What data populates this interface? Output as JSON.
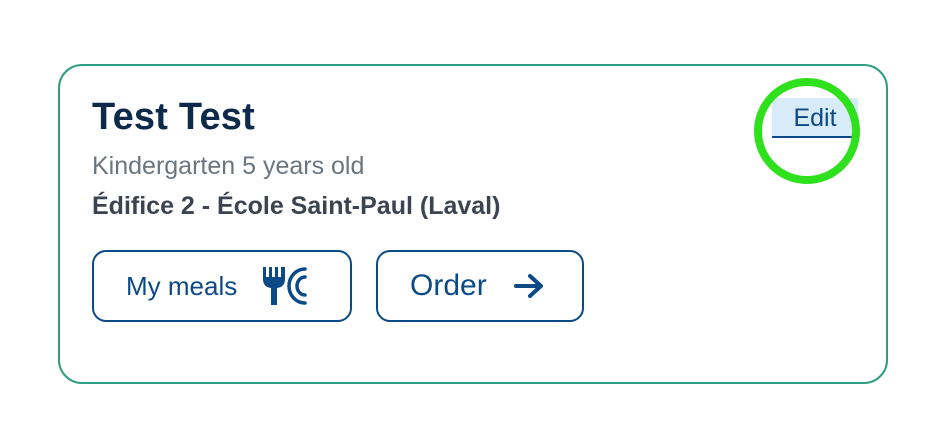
{
  "card": {
    "name": "Test Test",
    "grade": "Kindergarten 5 years old",
    "school": "Édifice 2 - École Saint-Paul (Laval)",
    "edit_label": "Edit",
    "meals_label": "My meals",
    "meals_icon": "fork-and-plate-icon",
    "order_label": "Order",
    "order_icon": "arrow-right-icon"
  },
  "colors": {
    "border": "#2e9e7f",
    "primary": "#0b4a86",
    "heading": "#0d2a4a",
    "highlight": "#2fe01c"
  }
}
